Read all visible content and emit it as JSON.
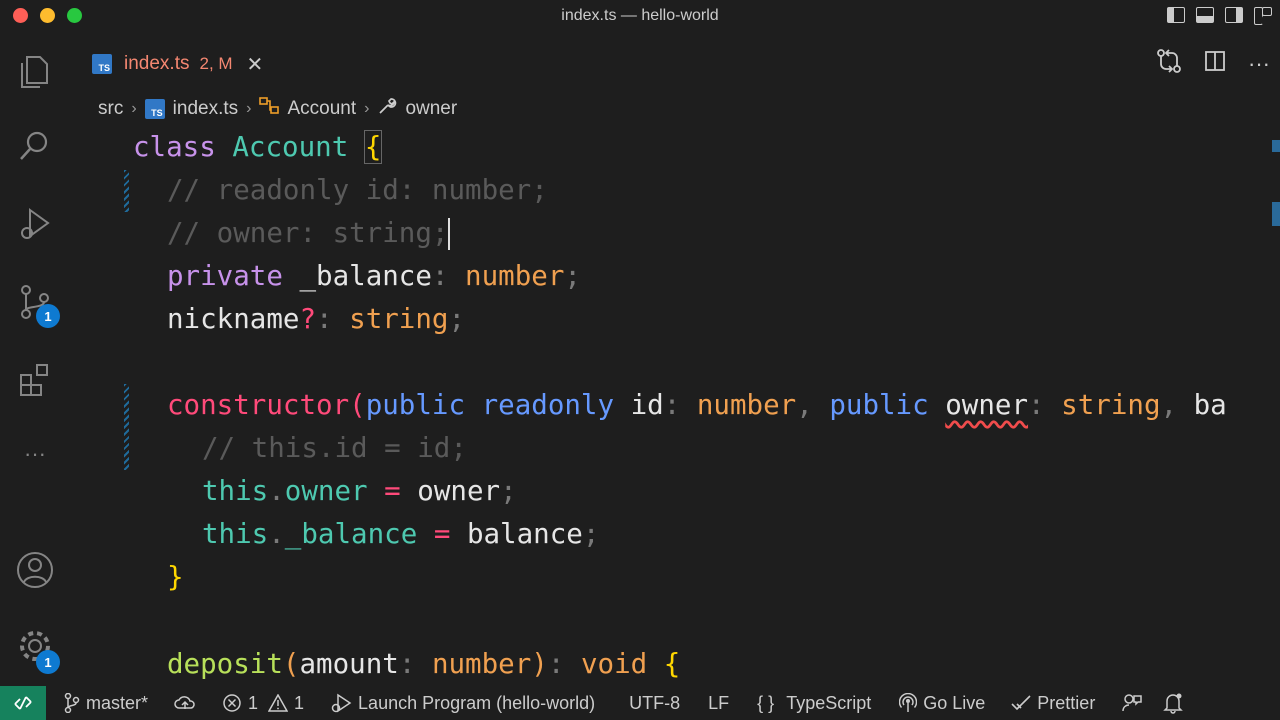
{
  "window": {
    "title": "index.ts — hello-world"
  },
  "tab": {
    "icon": "TS",
    "name": "index.ts",
    "status": "2, M"
  },
  "breadcrumb": {
    "folder": "src",
    "file": "index.ts",
    "class": "Account",
    "member": "owner"
  },
  "activity": {
    "scm_badge": "1",
    "settings_badge": "1",
    "more": "···"
  },
  "status": {
    "branch": "master*",
    "errors": "1",
    "warnings": "1",
    "launch": "Launch Program (hello-world)",
    "encoding": "UTF-8",
    "eol": "LF",
    "language_braces": "{ }",
    "language": "TypeScript",
    "golive": "Go Live",
    "prettier": "Prettier"
  },
  "code": {
    "l1": {
      "kw": "class",
      "name": "Account",
      "brace": "{"
    },
    "l2": "// readonly id: number;",
    "l3": "// owner: string;",
    "l4": {
      "kw": "private",
      "prop": "_balance",
      "colon": ":",
      "type": "number",
      "semi": ";"
    },
    "l5": {
      "prop": "nickname",
      "q": "?",
      "colon": ":",
      "type": "string",
      "semi": ";"
    },
    "l6": {
      "ctor": "constructor",
      "paren": "(",
      "kw1": "public",
      "kw2": "readonly",
      "p1": "id",
      "c1": ":",
      "t1": "number",
      "comma1": ",",
      "kw3": "public",
      "p2": "owner",
      "c2": ":",
      "t2": "string",
      "comma2": ",",
      "p3": "ba"
    },
    "l7": "// this.id = id;",
    "l8": {
      "this": "this",
      "dot": ".",
      "prop": "owner",
      "eq": "=",
      "val": "owner",
      "semi": ";"
    },
    "l9": {
      "this": "this",
      "dot": ".",
      "prop": "_balance",
      "eq": "=",
      "val": "balance",
      "semi": ";"
    },
    "l10": "}",
    "l11": {
      "fn": "deposit",
      "paren": "(",
      "arg": "amount",
      "colon": ":",
      "type": "number",
      "close": ")",
      "colon2": ":",
      "ret": "void",
      "brace": "{"
    }
  }
}
